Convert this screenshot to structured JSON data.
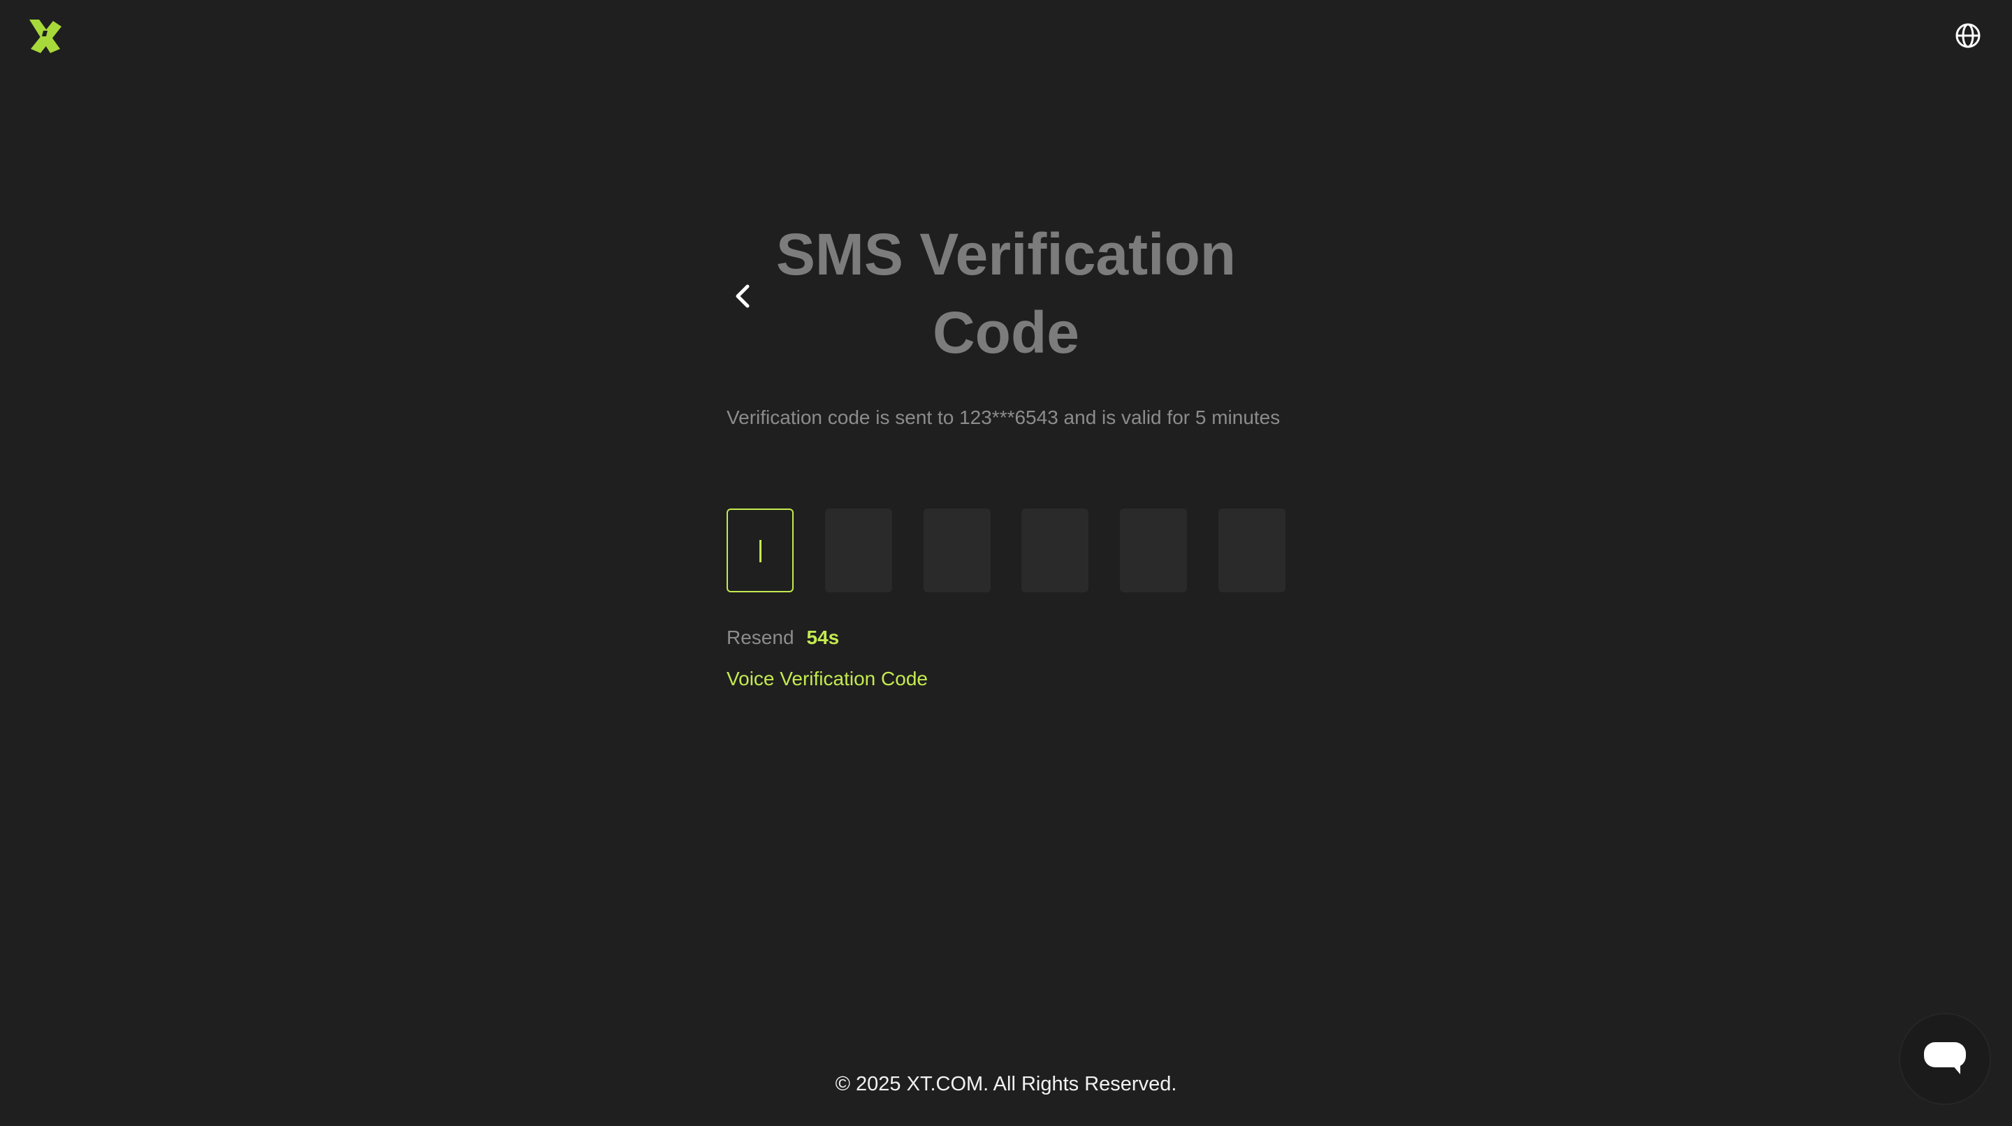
{
  "header": {
    "logo_icon": "xt-logo-icon",
    "language_icon": "globe-icon"
  },
  "main": {
    "back_icon": "chevron-left-icon",
    "title": "SMS Verification Code",
    "description": "Verification code is sent to 123***6543 and is valid for 5 minutes",
    "otp_digits": [
      "",
      "",
      "",
      "",
      "",
      ""
    ],
    "resend_label": "Resend",
    "resend_timer": "54s",
    "voice_link": "Voice Verification Code"
  },
  "footer": {
    "copyright": "© 2025 XT.COM. All Rights Reserved."
  },
  "support": {
    "chat_icon": "chat-bubble-icon"
  },
  "colors": {
    "background": "#1f1f1f",
    "accent": "#c4ea50",
    "title": "#7c7c7c",
    "muted_text": "#8c8c8c",
    "input_bg": "#2a2a2a"
  }
}
